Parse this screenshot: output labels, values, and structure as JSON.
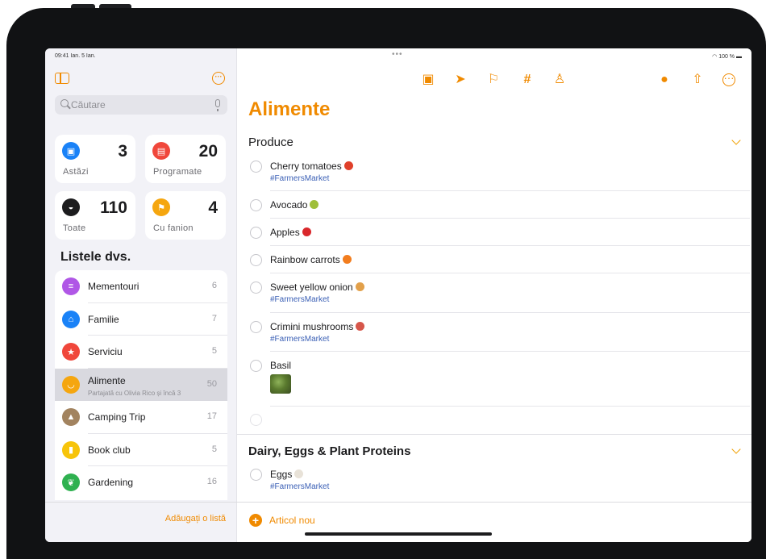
{
  "status_bar": {
    "left": "09:41 Ian. 5 Ian.",
    "right": "100 %"
  },
  "search": {
    "placeholder": "Căutare"
  },
  "smart_lists": [
    {
      "label": "Astăzi",
      "count": "3",
      "color": "#1a82f7",
      "icon": "calendar-today-icon"
    },
    {
      "label": "Programate",
      "count": "20",
      "color": "#f0473b",
      "icon": "calendar-icon"
    },
    {
      "label": "Toate",
      "count": "110",
      "color": "#1c1c1e",
      "icon": "tray-icon"
    },
    {
      "label": "Cu fanion",
      "count": "4",
      "color": "#f5a60f",
      "icon": "flag-icon"
    }
  ],
  "lists_title": "Listele dvs.",
  "lists": [
    {
      "name": "Mementouri",
      "count": "6",
      "color": "#b057e6",
      "icon": "list-icon"
    },
    {
      "name": "Familie",
      "count": "7",
      "color": "#1a82f7",
      "icon": "house-icon"
    },
    {
      "name": "Serviciu",
      "count": "5",
      "color": "#f0473b",
      "icon": "star-icon"
    },
    {
      "name": "Alimente",
      "count": "50",
      "color": "#f5a60f",
      "icon": "cart-icon",
      "subtitle": "Partajată cu Olivia Rico și încă 3"
    },
    {
      "name": "Camping Trip",
      "count": "17",
      "color": "#a2835f",
      "icon": "tent-icon"
    },
    {
      "name": "Book club",
      "count": "5",
      "color": "#f7c40a",
      "icon": "bookmark-icon"
    },
    {
      "name": "Gardening",
      "count": "16",
      "color": "#2fb150",
      "icon": "leaf-icon"
    }
  ],
  "add_list_label": "Adăugați o listă",
  "toolbar": {
    "icons": [
      "calendar-badge-icon",
      "location-icon",
      "flag-icon",
      "hashtag-icon",
      "person-icon",
      "share-people-icon",
      "share-icon",
      "more-icon"
    ]
  },
  "main": {
    "title": "Alimente",
    "sections": [
      {
        "title": "Produce",
        "items": [
          {
            "name": "Cherry tomatoes",
            "tag": "#FarmersMarket",
            "emoji_color": "#e0402a"
          },
          {
            "name": "Avocado",
            "emoji_color": "#9fbf3a"
          },
          {
            "name": "Apples",
            "emoji_color": "#d9272b"
          },
          {
            "name": "Rainbow carrots",
            "emoji_color": "#f27d1e"
          },
          {
            "name": "Sweet yellow onion",
            "tag": "#FarmersMarket",
            "emoji_color": "#e2a04a"
          },
          {
            "name": "Crimini mushrooms",
            "tag": "#FarmersMarket",
            "emoji_color": "#d6564a"
          },
          {
            "name": "Basil"
          }
        ]
      },
      {
        "title": "Dairy, Eggs & Plant Proteins",
        "items": [
          {
            "name": "Eggs",
            "tag": "#FarmersMarket",
            "emoji_color": "#e8e2d8"
          }
        ]
      }
    ]
  },
  "new_item_label": "Articol nou"
}
